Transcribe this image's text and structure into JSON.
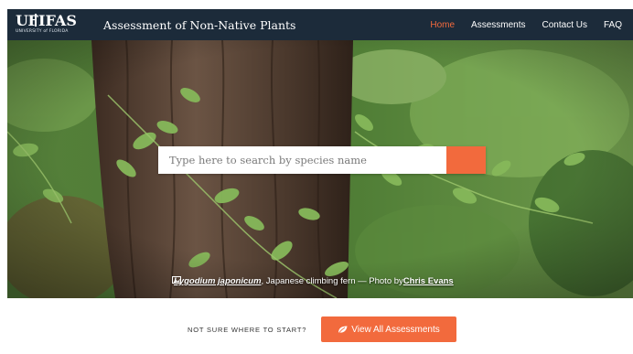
{
  "header": {
    "logo_text": "UF | IFAS",
    "logo_uf": "UF",
    "logo_ifas": "IFAS",
    "logo_subtext": "UNIVERSITY of FLORIDA",
    "site_title": "Assessment of Non-Native Plants"
  },
  "nav": {
    "items": [
      {
        "label": "Home",
        "active": true
      },
      {
        "label": "Assessments",
        "active": false
      },
      {
        "label": "Contact Us",
        "active": false
      },
      {
        "label": "FAQ",
        "active": false
      }
    ]
  },
  "search": {
    "placeholder": "Type here to search by species name",
    "button_icon": "search-icon"
  },
  "hero_caption": {
    "icon": "image-icon",
    "species": "Lygodium japonicum",
    "common_name": ", Japanese climbing fern — Photo by ",
    "photographer": "Chris Evans"
  },
  "cta": {
    "prompt": "NOT SURE WHERE TO START?",
    "button_label": "View All Assessments",
    "button_icon": "leaf-icon"
  },
  "colors": {
    "navbar": "#1c2b3a",
    "accent": "#f26a3d",
    "hero_foliage": "#4a7a35"
  }
}
